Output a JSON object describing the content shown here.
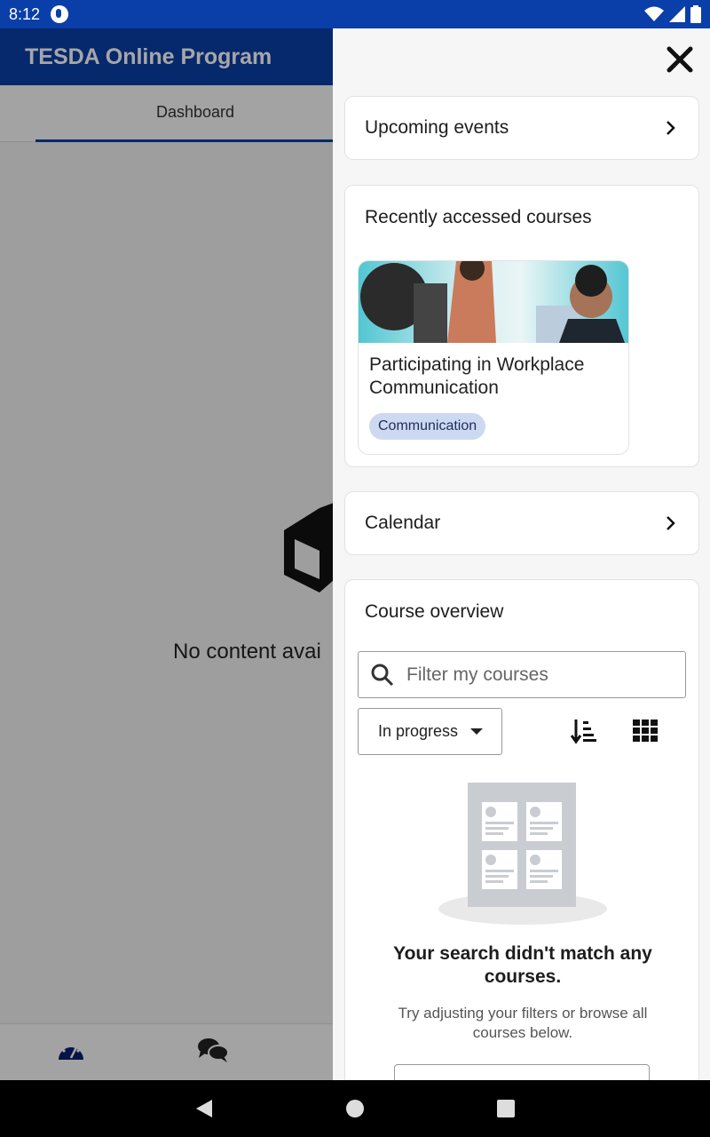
{
  "status_bar": {
    "time": "8:12"
  },
  "app": {
    "title": "TESDA Online Program",
    "tab_dashboard": "Dashboard",
    "empty_text": "No content avai"
  },
  "drawer": {
    "upcoming_events": "Upcoming events",
    "recent_courses": {
      "title": "Recently accessed courses",
      "course_name": "Participating in Workplace Communication",
      "course_tag": "Communication"
    },
    "calendar": "Calendar",
    "course_overview": {
      "title": "Course overview",
      "filter_placeholder": "Filter my courses",
      "filter_selected": "In progress",
      "no_match_title": "Your search didn't match any courses.",
      "no_match_hint": "Try adjusting your filters or browse all courses below."
    }
  },
  "colors": {
    "brand": "#0a3ea8",
    "tag_bg": "#cdd9f1"
  }
}
